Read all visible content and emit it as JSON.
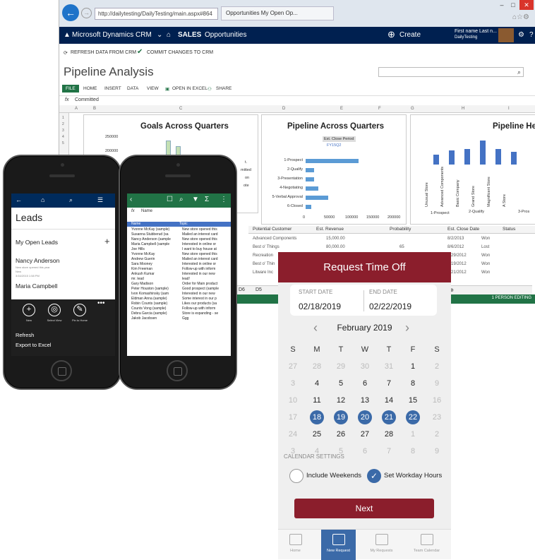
{
  "browser": {
    "url": "http://dailytesting/DailyTesting/main.aspx#864",
    "tab_title": "Opportunities My Open Op...",
    "crm": {
      "app_name": "Microsoft Dynamics CRM",
      "area": "SALES",
      "entity": "Opportunities",
      "create_label": "Create",
      "user_name": "First name Last n...",
      "org_name": "DailyTesting"
    },
    "commands": {
      "refresh": "REFRESH DATA FROM CRM",
      "commit": "COMMIT CHANGES TO CRM"
    },
    "page_title": "Pipeline Analysis",
    "ribbon": [
      "FILE",
      "HOME",
      "INSERT",
      "DATA",
      "VIEW",
      "OPEN IN EXCEL",
      "SHARE"
    ],
    "formula_value": "Committed",
    "columns": [
      "A",
      "B",
      "C",
      "D",
      "E",
      "F",
      "G",
      "H",
      "I"
    ],
    "rows": [
      "1",
      "2",
      "3",
      "4",
      "5"
    ],
    "chart1": {
      "title": "Goals Across Quarters",
      "ticks": [
        "250000",
        "200000"
      ]
    },
    "chart2": {
      "title": "Pipeline Across Quarters",
      "filter_label": "Est. Close Period",
      "legend": "FY15Q2",
      "categories": [
        "1-Prospect",
        "2-Qualify",
        "3-Presentation",
        "4-Negotiating",
        "5-Verbal Approval",
        "6-Closed"
      ],
      "xticks": [
        "0",
        "50000",
        "100000",
        "150000",
        "200000"
      ]
    },
    "chart3": {
      "title": "Pipeline He",
      "categories": [
        "Unusual Store",
        "Advanced Components",
        "Basic Company",
        "Grand Store",
        "Magnificent Store",
        "A Store"
      ],
      "groups": [
        "1-Prospect",
        "2-Qualify",
        "3-Pros"
      ]
    },
    "chart1_side": [
      "t.",
      "mitted",
      "on",
      "ote"
    ],
    "table": {
      "headers": [
        "Potential Customer",
        "Est. Revenue",
        "Probability",
        "Est. Close Date",
        "Status"
      ],
      "rows": [
        [
          "Advanced Components",
          "15,000.00",
          "",
          "8/2/2013",
          "Won"
        ],
        [
          "Best o' Things",
          "80,000.00",
          "65",
          "8/6/2012",
          "Lost"
        ],
        [
          "Recreation",
          "",
          "",
          "8/29/2012",
          "Won"
        ],
        [
          "Best o' Thin",
          "",
          "",
          "9/19/2012",
          "Won"
        ],
        [
          "Litware Inc",
          "",
          "",
          "9/21/2012",
          "Won"
        ]
      ]
    },
    "sheet_tabs": [
      "D6",
      "D5"
    ],
    "status": "1 PERSON EDITING"
  },
  "phone_left": {
    "title": "Leads",
    "section": "My Open Leads",
    "leads": [
      {
        "name": "Nancy Anderson",
        "sub": "New store opened this year",
        "sub2": "New",
        "date": "3/16/2015 1:58 PM"
      },
      {
        "name": "Maria Campbell"
      }
    ],
    "actions": [
      {
        "label": "New"
      },
      {
        "label": "Select View"
      },
      {
        "label": "Pin to Home"
      }
    ],
    "menu": [
      "Refresh",
      "Export to Excel"
    ]
  },
  "phone_right": {
    "fx_value": "Name",
    "header": [
      "Name",
      "Topic"
    ],
    "rows": [
      [
        "Yvonne McKay (sample)",
        "New store opened this"
      ],
      [
        "Susanna Stubberud (sa",
        "Mailed an interest card"
      ],
      [
        "Nancy Anderson (sample",
        "New store opened this"
      ],
      [
        "Maria Campbell (sample",
        "Interested in online or"
      ],
      [
        "Joe Hills",
        "I want to buy house at"
      ],
      [
        "Yvonne McKay",
        "New store opened this"
      ],
      [
        "Andrew Guerin",
        "Mailed an interest card"
      ],
      [
        "Sara Mooney",
        "Interested in online or"
      ],
      [
        "Kim Freeman",
        "Follow-up with inform"
      ],
      [
        "Ankush Kumar",
        "Interested in our new"
      ],
      [
        "mr. lead",
        "lead!"
      ],
      [
        "Gary Madison",
        "Order for Main product"
      ],
      [
        "Peter Houston (sample)",
        "Good prospect (sample"
      ],
      [
        "Ivon Komashinsky (sam",
        "Interested in our new"
      ],
      [
        "Eldman Anna (sample)",
        "Some interest in our p"
      ],
      [
        "Robin Counts (sample)",
        "Likes our products (sa"
      ],
      [
        "Counts Vong (sample)",
        "Follow-up with inform"
      ],
      [
        "Debra Garcia (sample)",
        "Store is expanding - se"
      ],
      [
        "Jakob Jacobsen",
        "Ggg"
      ]
    ]
  },
  "time_off": {
    "title": "Request Time Off",
    "start_label": "START DATE",
    "start_value": "02/18/2019",
    "end_label": "END DATE",
    "end_value": "02/22/2019",
    "month": "February 2019",
    "weekdays": [
      "S",
      "M",
      "T",
      "W",
      "T",
      "F",
      "S"
    ],
    "weeks": [
      [
        [
          "27",
          0
        ],
        [
          "28",
          0
        ],
        [
          "29",
          0
        ],
        [
          "30",
          0
        ],
        [
          "31",
          0
        ],
        [
          "1",
          1
        ],
        [
          "2",
          0
        ]
      ],
      [
        [
          "3",
          0
        ],
        [
          "4",
          1
        ],
        [
          "5",
          1
        ],
        [
          "6",
          1
        ],
        [
          "7",
          1
        ],
        [
          "8",
          1
        ],
        [
          "9",
          0
        ]
      ],
      [
        [
          "10",
          0
        ],
        [
          "11",
          1
        ],
        [
          "12",
          1
        ],
        [
          "13",
          1
        ],
        [
          "14",
          1
        ],
        [
          "15",
          1
        ],
        [
          "16",
          0
        ]
      ],
      [
        [
          "17",
          0
        ],
        [
          "18",
          2
        ],
        [
          "19",
          2
        ],
        [
          "20",
          2
        ],
        [
          "21",
          2
        ],
        [
          "22",
          2
        ],
        [
          "23",
          0
        ]
      ],
      [
        [
          "24",
          0
        ],
        [
          "25",
          1
        ],
        [
          "26",
          1
        ],
        [
          "27",
          1
        ],
        [
          "28",
          1
        ],
        [
          "1",
          0
        ],
        [
          "2",
          0
        ]
      ],
      [
        [
          "3",
          0
        ],
        [
          "4",
          0
        ],
        [
          "5",
          0
        ],
        [
          "6",
          0
        ],
        [
          "7",
          0
        ],
        [
          "8",
          0
        ],
        [
          "9",
          0
        ]
      ]
    ],
    "settings_label": "CALENDAR SETTINGS",
    "include_weekends": "Include Weekends",
    "set_workday": "Set Workday Hours",
    "next": "Next",
    "tabs": [
      "Home",
      "New Request",
      "My Requests",
      "Team Calendar"
    ],
    "accent": "#8b1e2c",
    "select_color": "#3b6aa8"
  }
}
